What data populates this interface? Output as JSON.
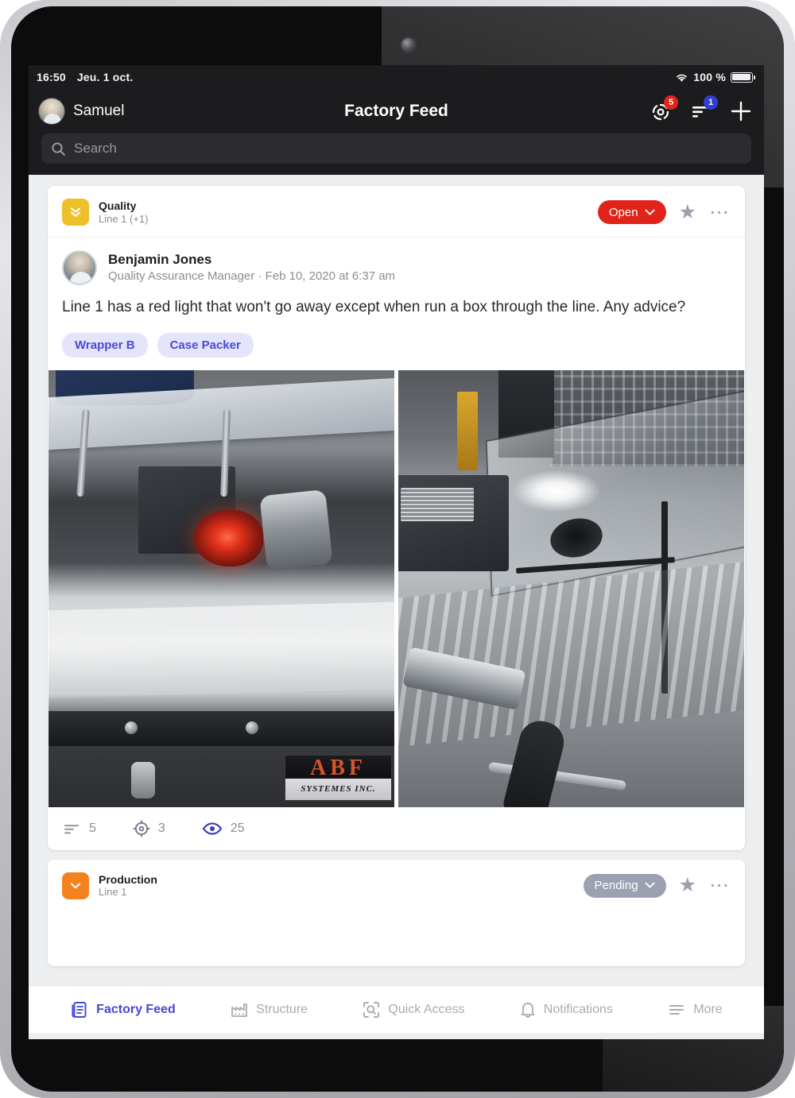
{
  "status_bar": {
    "time": "16:50",
    "date": "Jeu. 1 oct.",
    "battery_percent": "100 %"
  },
  "header": {
    "user_name": "Samuel",
    "title": "Factory Feed",
    "notifications_badge": "5",
    "filter_badge": "1"
  },
  "search": {
    "placeholder": "Search",
    "value": ""
  },
  "posts": [
    {
      "category": "Quality",
      "location": "Line 1 (+1)",
      "category_color": "#efc02a",
      "category_icon": "double-chevron-down-icon",
      "status": "Open",
      "status_color": "#e2231a",
      "status_text_color": "#ffffff",
      "author_name": "Benjamin Jones",
      "author_role": "Quality Assurance Manager · Feb 10, 2020 at 6:37 am",
      "body": "Line 1 has a red light that won't go away except when run a box through the line. Any advice?",
      "tags": [
        "Wrapper B",
        "Case Packer"
      ],
      "photo_left_label_brand": "ABF",
      "photo_left_label_sub": "SYSTEMES INC.",
      "stats": {
        "comments": "5",
        "tasks": "3",
        "views": "25"
      }
    },
    {
      "category": "Production",
      "location": "Line 1",
      "category_color": "#f58220",
      "category_icon": "chevron-down-icon",
      "status": "Pending",
      "status_color": "#9ba1b0",
      "status_text_color": "#ffffff"
    }
  ],
  "tabbar": [
    {
      "label": "Factory Feed",
      "icon": "feed-document-icon",
      "active": true
    },
    {
      "label": "Structure",
      "icon": "factory-icon",
      "active": false
    },
    {
      "label": "Quick Access",
      "icon": "scan-search-icon",
      "active": false
    },
    {
      "label": "Notifications",
      "icon": "bell-icon",
      "active": false
    },
    {
      "label": "More",
      "icon": "hamburger-icon",
      "active": false
    }
  ],
  "colors": {
    "accent": "#4646d6",
    "tag_bg": "#e4e5fb",
    "tag_text": "#4a4ad8",
    "feed_bg": "#eceef0",
    "navbar_bg": "#1c1c1e"
  }
}
